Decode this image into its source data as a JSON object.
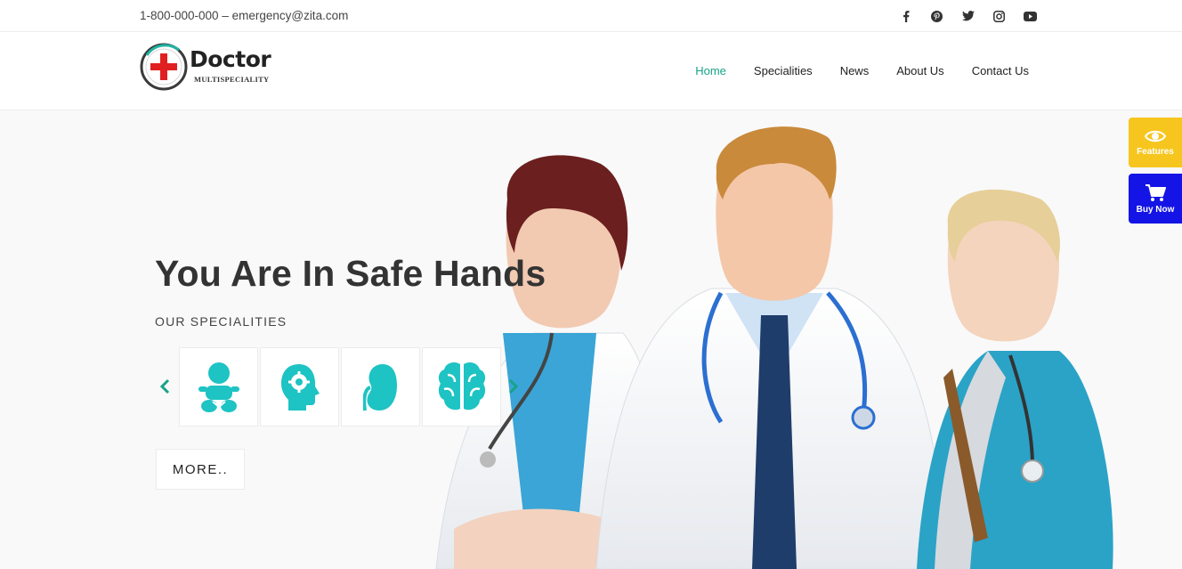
{
  "topbar": {
    "contact": "1-800-000-000 – emergency@zita.com",
    "socials": [
      "facebook-icon",
      "pinterest-icon",
      "twitter-icon",
      "instagram-icon",
      "youtube-icon"
    ]
  },
  "logo": {
    "name": "Doctor",
    "tagline": "MULTISPECIALITY"
  },
  "nav": {
    "items": [
      {
        "label": "Home",
        "active": true
      },
      {
        "label": "Specialities",
        "active": false
      },
      {
        "label": "News",
        "active": false
      },
      {
        "label": "About Us",
        "active": false
      },
      {
        "label": "Contact Us",
        "active": false
      }
    ]
  },
  "hero": {
    "title": "You Are In Safe Hands",
    "subtitle": "OUR SPECIALITIES",
    "specialities": [
      "baby-icon",
      "head-gear-icon",
      "kidney-icon",
      "brain-icon"
    ],
    "more_label": "MORE.."
  },
  "side": {
    "features_label": "Features",
    "buy_label": "Buy Now"
  },
  "colors": {
    "accent": "#16a387",
    "icon_teal": "#1ec3c3",
    "features_bg": "#f6c61f",
    "buy_bg": "#1414e6"
  }
}
